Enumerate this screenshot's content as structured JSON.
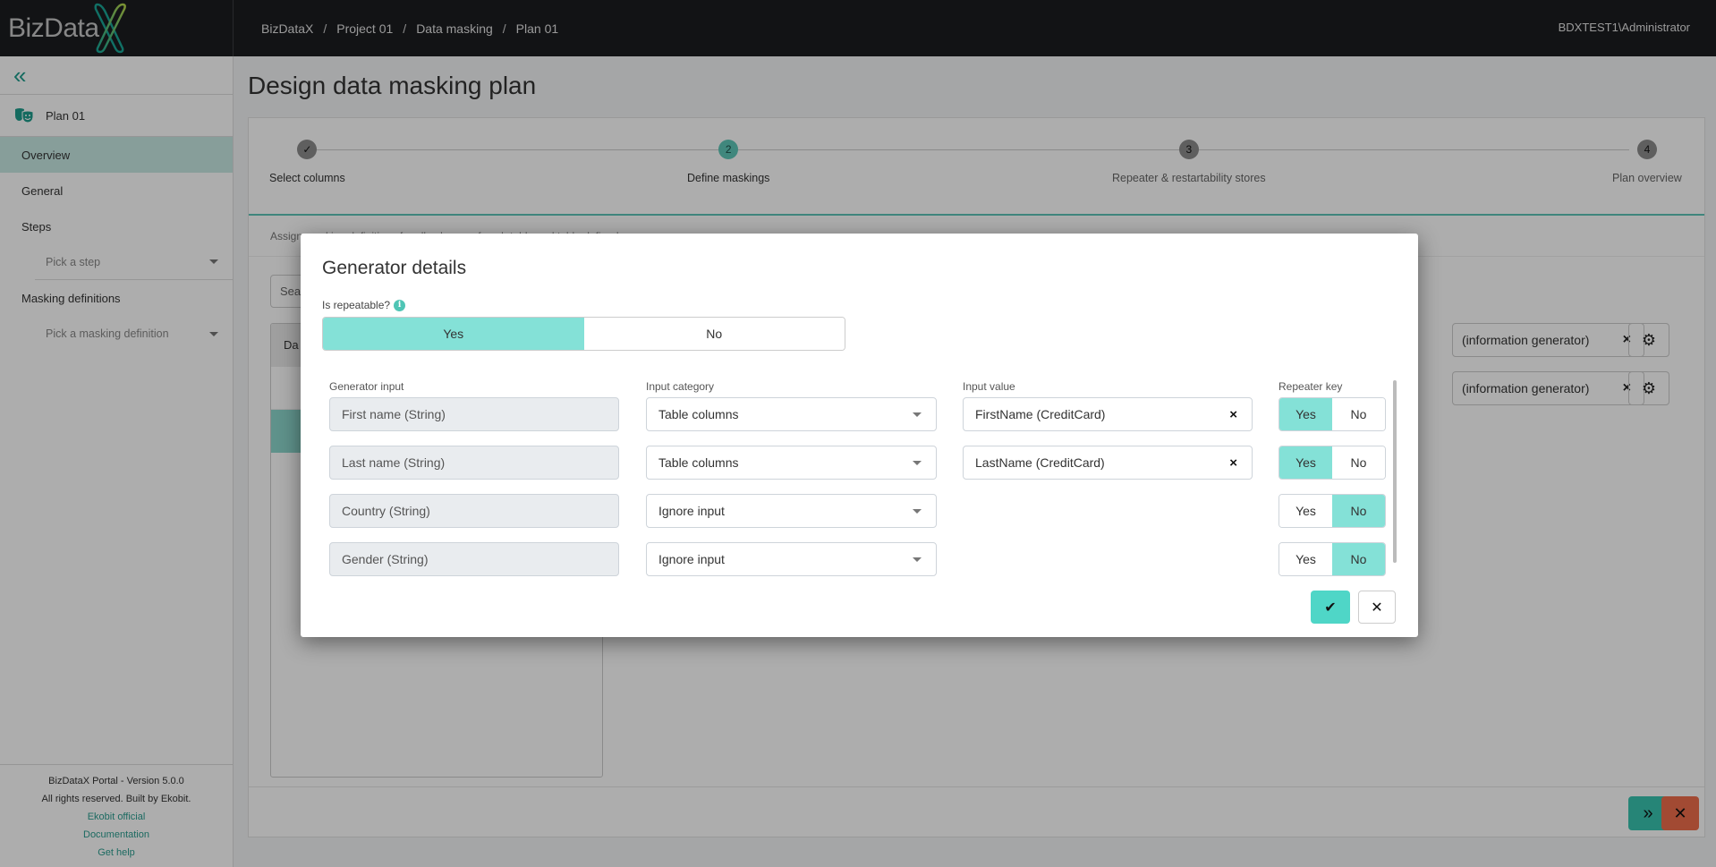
{
  "app": {
    "logo_text": "BizData",
    "user": "BDXTEST1\\Administrator"
  },
  "breadcrumb": [
    "BizDataX",
    "Project 01",
    "Data masking",
    "Plan 01"
  ],
  "sidebar": {
    "plan_name": "Plan 01",
    "items": [
      {
        "label": "Overview",
        "active": true
      },
      {
        "label": "General"
      },
      {
        "label": "Steps"
      },
      {
        "label": "Masking definitions"
      }
    ],
    "step_picker_placeholder": "Pick a step",
    "masking_picker_placeholder": "Pick a masking definition",
    "footer": {
      "version": "BizDataX Portal - Version 5.0.0",
      "rights": "All rights reserved. Built by Ekobit.",
      "links": [
        "Ekobit official",
        "Documentation",
        "Get help"
      ]
    }
  },
  "page": {
    "title": "Design data masking plan",
    "steps": [
      {
        "number": "✓",
        "label": "Select columns",
        "state": "done"
      },
      {
        "number": "2",
        "label": "Define maskings",
        "state": "current"
      },
      {
        "number": "3",
        "label": "Repeater & restartability stores",
        "state": "pending"
      },
      {
        "number": "4",
        "label": "Plan overview",
        "state": "pending"
      }
    ],
    "subtitle": "Assign masking definitions for all columns of each table and table defined",
    "search_placeholder": "Sea",
    "list_header": "Da",
    "generators": [
      {
        "value": "(information generator)"
      },
      {
        "value": "(information generator)"
      }
    ]
  },
  "modal": {
    "title": "Generator details",
    "repeatable_label": "Is repeatable?",
    "repeatable_options": [
      "Yes",
      "No"
    ],
    "repeatable_selected": "Yes",
    "columns": {
      "generator_input": "Generator input",
      "input_category": "Input category",
      "input_value": "Input value",
      "repeater_key": "Repeater key"
    },
    "rows": [
      {
        "generator_input": "First name (String)",
        "input_category": "Table columns",
        "input_value": "FirstName (CreditCard)",
        "repeater_key": "Yes"
      },
      {
        "generator_input": "Last name (String)",
        "input_category": "Table columns",
        "input_value": "LastName (CreditCard)",
        "repeater_key": "Yes"
      },
      {
        "generator_input": "Country (String)",
        "input_category": "Ignore input",
        "input_value": "",
        "repeater_key": "No"
      },
      {
        "generator_input": "Gender (String)",
        "input_category": "Ignore input",
        "input_value": "",
        "repeater_key": "No"
      }
    ],
    "yes_label": "Yes",
    "no_label": "No"
  },
  "colors": {
    "accent": "#4fd6c7",
    "toggle_on": "#84e1d7",
    "cancel": "#ef6e4c",
    "topbar": "#1b1c20"
  }
}
